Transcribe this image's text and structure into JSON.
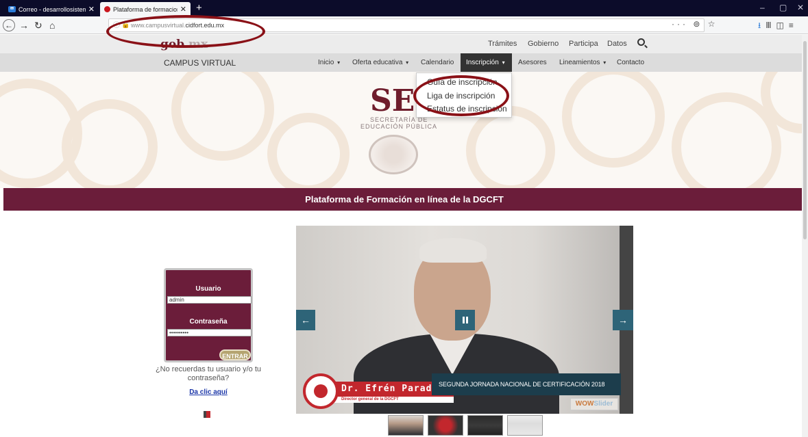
{
  "browser": {
    "tabs": [
      {
        "label": "Correo - desarrollosistemas.cic",
        "active": false
      },
      {
        "label": "Plataforma de formacion en lin",
        "active": true
      }
    ],
    "url_prefix": "www.campusvirtual.",
    "url_domain": "cidfort.edu.mx",
    "new_tab": "+",
    "controls": {
      "minimize": "–",
      "restore": "▢",
      "close": "✕"
    },
    "nav": {
      "back": "←",
      "forward": "→",
      "reload": "↻",
      "home": "⌂"
    },
    "url_actions": "··· ⊚ ☆",
    "right_tools": {
      "download": "⭳",
      "library": "Ⅲ",
      "sidebar": "◫",
      "menu": "≡"
    }
  },
  "gob_bar": {
    "logo_main": "gob",
    "logo_suffix": ".mx",
    "links": [
      "Trámites",
      "Gobierno",
      "Participa",
      "Datos"
    ]
  },
  "main_nav": {
    "site_title": "CAMPUS VIRTUAL",
    "items": [
      {
        "label": "Inicio",
        "caret": true
      },
      {
        "label": "Oferta educativa",
        "caret": true
      },
      {
        "label": "Calendario",
        "caret": false
      },
      {
        "label": "Inscripción",
        "caret": true,
        "active": true
      },
      {
        "label": "Asesores",
        "caret": false
      },
      {
        "label": "Lineamientos",
        "caret": true
      },
      {
        "label": "Contacto",
        "caret": false
      }
    ],
    "caret_glyph": "▾"
  },
  "dropdown": {
    "items": [
      "Guía de inscripción",
      "Liga de inscripción",
      "Estatus de inscripción"
    ]
  },
  "hero": {
    "logo": "SEP",
    "line1": "SECRETARÍA DE",
    "line2": "EDUCACIÓN PÚBLICA"
  },
  "banner": {
    "title": "Plataforma de Formación en línea de la DGCFT"
  },
  "login": {
    "user_label": "Usuario",
    "user_value": "admin",
    "password_label": "Contraseña",
    "password_value": "••••••••••",
    "submit_label": "ENTRAR",
    "forgot_text": "¿No recuerdas tu usuario y/o tu contraseña?",
    "forgot_link": "Da clic aquí"
  },
  "slider": {
    "arrow_left": "←",
    "arrow_right": "→",
    "name_overlay": "Dr. Efrén Parada",
    "title_overlay": "Director general de la DGCFT",
    "caption": "SEGUNDA JORNADA NACIONAL DE CERTIFICACIÓN 2018",
    "brand_main": "WOW",
    "brand_suffix": "Slider"
  },
  "colors": {
    "guinda": "#6b1d3a",
    "slider_button": "#2e6478",
    "caption_bg": "#1c3d4c",
    "annotation_ring": "#8a1117"
  }
}
